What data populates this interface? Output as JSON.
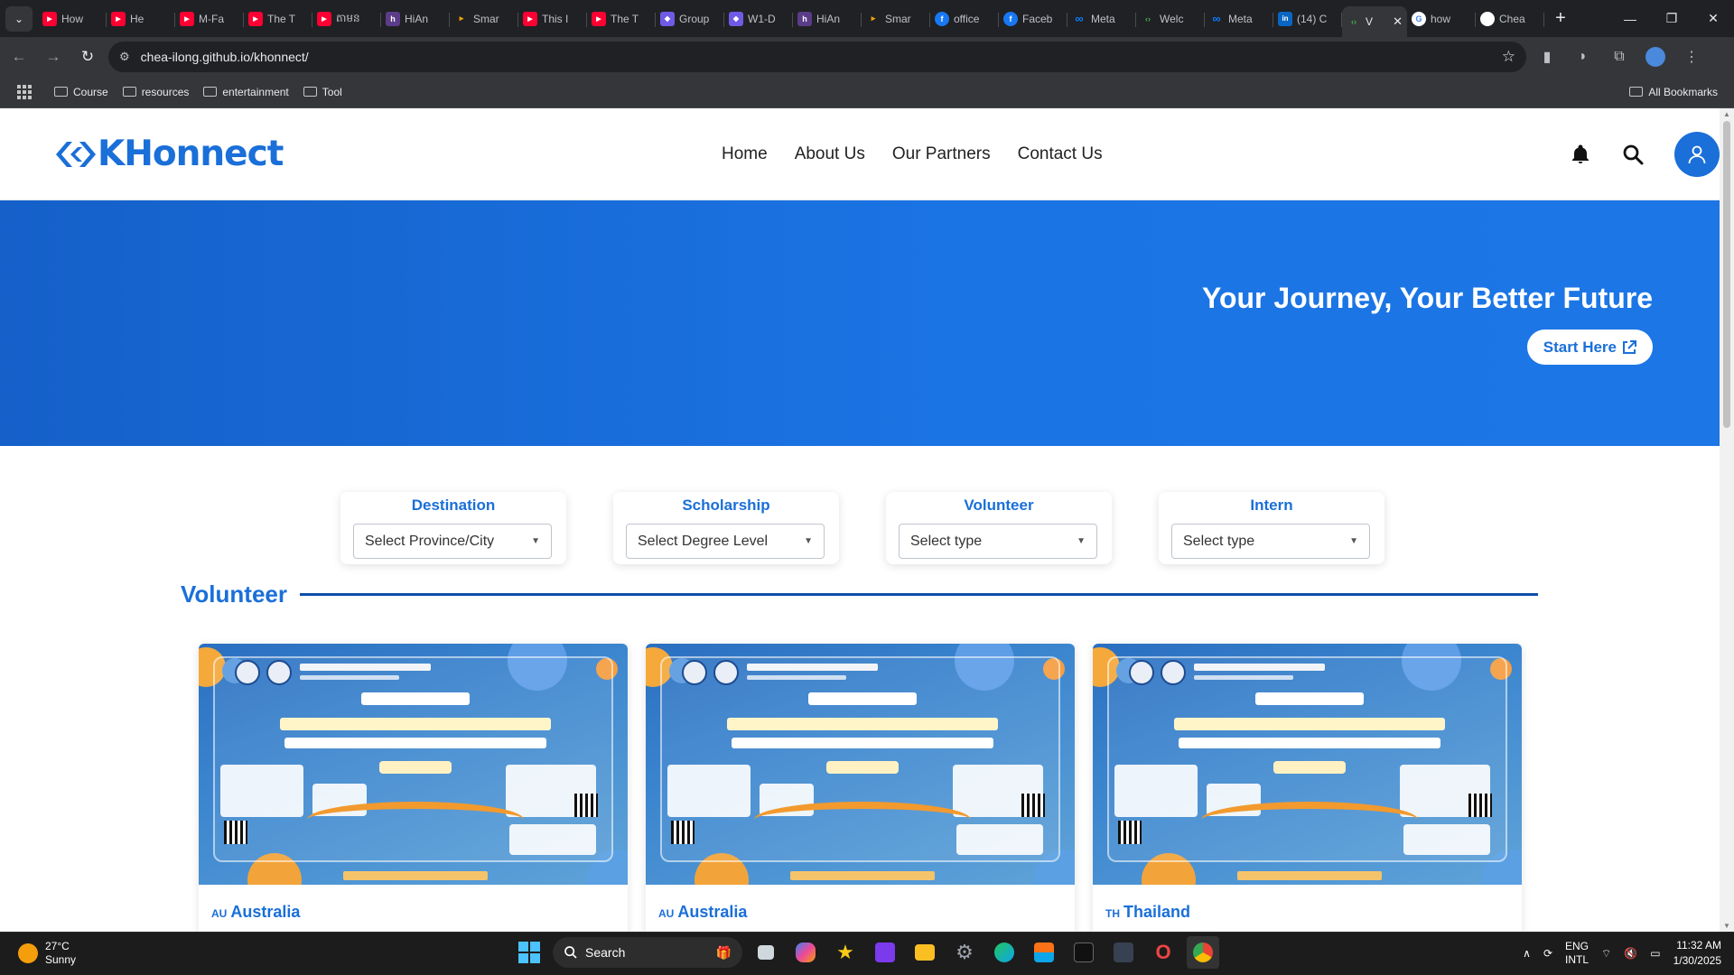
{
  "browser": {
    "tabs": [
      {
        "title": "How",
        "icon": "youtube-icon",
        "color": "#ff0033"
      },
      {
        "title": "He",
        "icon": "youtube-icon",
        "color": "#ff0033"
      },
      {
        "title": "M-Fa",
        "icon": "youtube-icon",
        "color": "#ff0033"
      },
      {
        "title": "The T",
        "icon": "youtube-icon",
        "color": "#ff0033"
      },
      {
        "title": "តាមន",
        "icon": "youtube-icon",
        "color": "#ff0033"
      },
      {
        "title": "HiAn",
        "icon": "hianime-icon",
        "color": "#5b3c88"
      },
      {
        "title": "Smar",
        "icon": "bookmark-icon",
        "color": "#f0a30a"
      },
      {
        "title": "This I",
        "icon": "youtube-icon",
        "color": "#ff0033"
      },
      {
        "title": "The T",
        "icon": "youtube-icon",
        "color": "#ff0033"
      },
      {
        "title": "Group",
        "icon": "shield-icon",
        "color": "#6f5ae6"
      },
      {
        "title": "W1-D",
        "icon": "shield-icon",
        "color": "#6f5ae6"
      },
      {
        "title": "HiAn",
        "icon": "hianime-icon",
        "color": "#5b3c88"
      },
      {
        "title": "Smar",
        "icon": "bookmark-icon",
        "color": "#f0a30a"
      },
      {
        "title": "office",
        "icon": "facebook-icon",
        "color": "#1877f2"
      },
      {
        "title": "Faceb",
        "icon": "facebook-icon",
        "color": "#1877f2"
      },
      {
        "title": "Meta",
        "icon": "meta-icon",
        "color": "#0a7cff"
      },
      {
        "title": "Welc",
        "icon": "code-icon",
        "color": "#4caf50"
      },
      {
        "title": "Meta",
        "icon": "meta-icon",
        "color": "#0a7cff"
      },
      {
        "title": "(14) C",
        "icon": "linkedin-icon",
        "color": "#0a66c2"
      },
      {
        "title": "V",
        "icon": "code-icon",
        "color": "#4caf50",
        "active": true
      },
      {
        "title": "how",
        "icon": "google-icon",
        "color": "#ffffff"
      },
      {
        "title": "Chea",
        "icon": "github-icon",
        "color": "#ffffff"
      }
    ],
    "url": "chea-ilong.github.io/khonnect/",
    "bookmarks": [
      "Course",
      "resources",
      "entertainment",
      "Tool"
    ],
    "all_bookmarks": "All Bookmarks"
  },
  "site": {
    "logo_text": "KHonnect",
    "nav": [
      "Home",
      "About Us",
      "Our Partners",
      "Contact Us"
    ],
    "brand_color": "#1a6fd8"
  },
  "hero": {
    "headline": "Your Journey, Your Better Future",
    "cta": "Start Here"
  },
  "filters": [
    {
      "label": "Destination",
      "placeholder": "Select Province/City"
    },
    {
      "label": "Scholarship",
      "placeholder": "Select Degree Level"
    },
    {
      "label": "Volunteer",
      "placeholder": "Select type"
    },
    {
      "label": "Intern",
      "placeholder": "Select type"
    }
  ],
  "section": {
    "title": "Volunteer"
  },
  "cards": [
    {
      "code": "AU",
      "country": "Australia"
    },
    {
      "code": "AU",
      "country": "Australia"
    },
    {
      "code": "TH",
      "country": "Thailand"
    }
  ],
  "taskbar": {
    "temp": "27°C",
    "weather": "Sunny",
    "search": "Search",
    "lang1": "ENG",
    "lang2": "INTL",
    "time": "11:32 AM",
    "date": "1/30/2025"
  }
}
